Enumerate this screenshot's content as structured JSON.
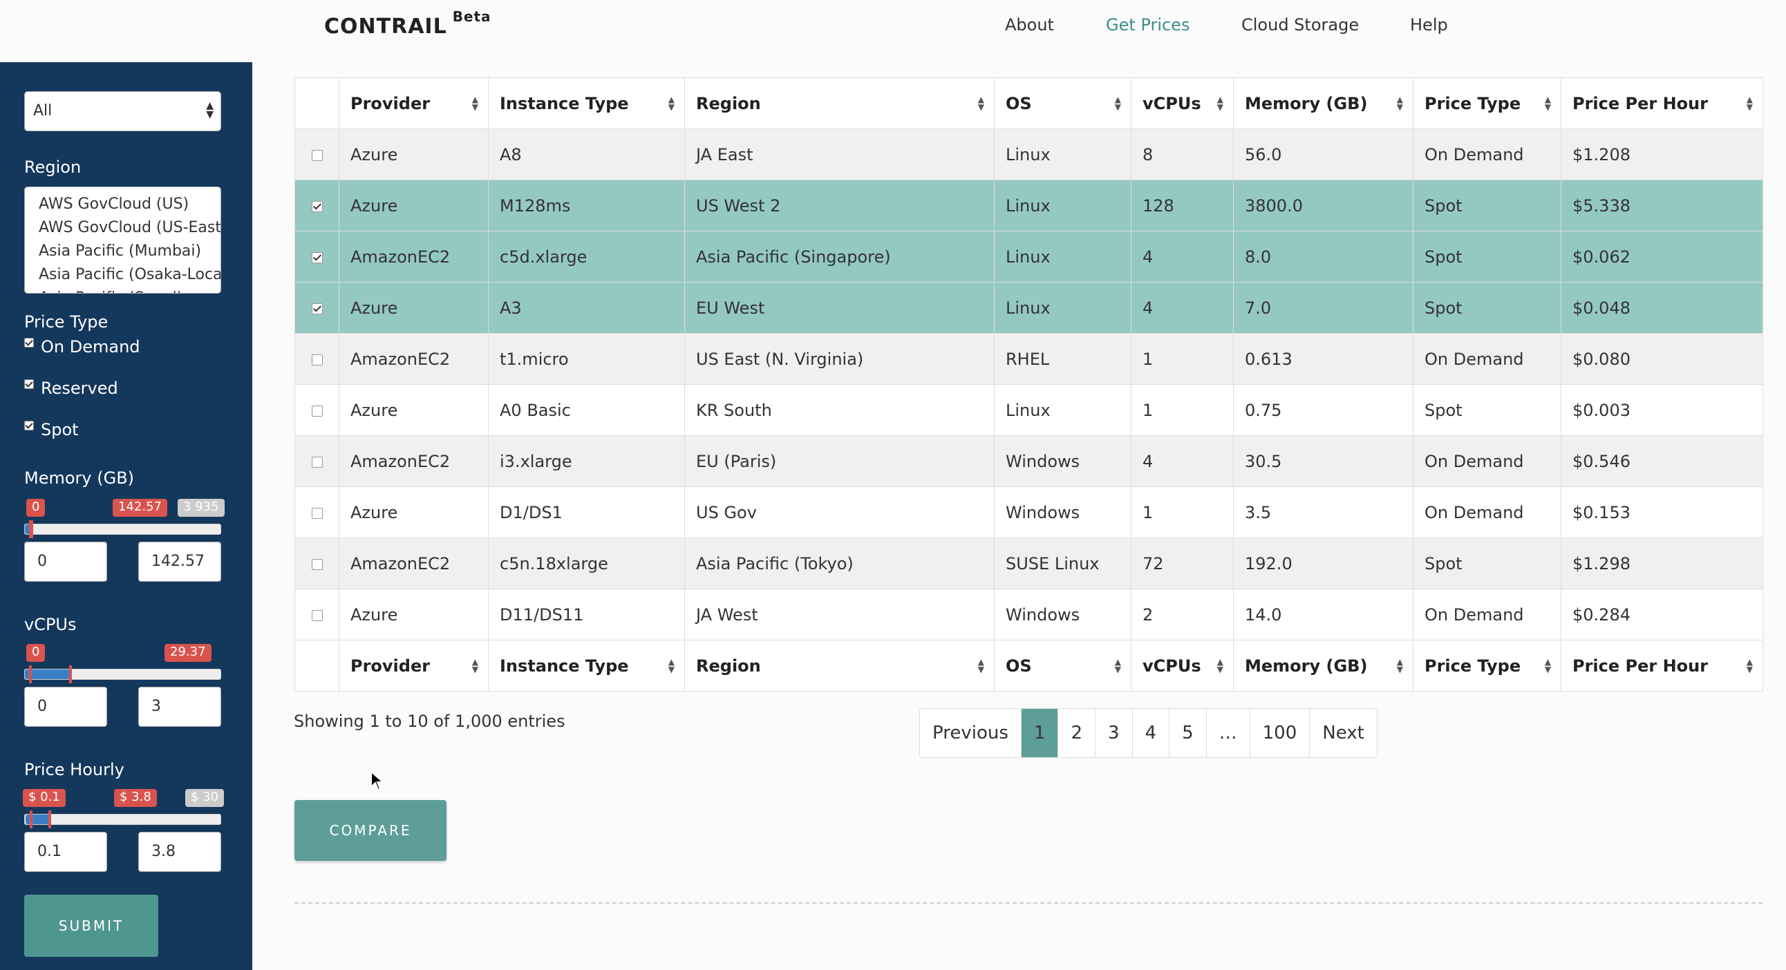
{
  "header": {
    "logo": "CONTRAIL",
    "logo_badge": "Beta",
    "nav": [
      "About",
      "Get Prices",
      "Cloud Storage",
      "Help"
    ]
  },
  "sidebar": {
    "provider_select": "All",
    "region_label": "Region",
    "regions": [
      "AWS GovCloud (US)",
      "AWS GovCloud (US-East)",
      "Asia Pacific (Mumbai)",
      "Asia Pacific (Osaka-Local)",
      "Asia Pacific (Seoul)"
    ],
    "price_type_label": "Price Type",
    "price_types": [
      {
        "label": "On Demand",
        "checked": true
      },
      {
        "label": "Reserved",
        "checked": true
      },
      {
        "label": "Spot",
        "checked": true
      }
    ],
    "memory": {
      "label": "Memory (GB)",
      "min_tag": "0",
      "cur_tag": "142.57",
      "max_tag": "3 935",
      "min": "0",
      "max": "142.57",
      "lo_frac": 0.0,
      "hi_frac": 0.036
    },
    "vcpus": {
      "label": "vCPUs",
      "min_tag": "0",
      "cur_tag": "29.37",
      "min": "0",
      "max": "3",
      "lo_frac": 0.0,
      "hi_frac": 0.23
    },
    "price_hourly": {
      "label": "Price Hourly",
      "min_tag": "$ 0.1",
      "cur_tag": "$ 3.8",
      "max_tag": "$ 30",
      "min": "0.1",
      "max": "3.8",
      "lo_frac": 0.003,
      "hi_frac": 0.127
    },
    "submit": "SUBMIT"
  },
  "table": {
    "columns": [
      "Provider",
      "Instance Type",
      "Region",
      "OS",
      "vCPUs",
      "Memory (GB)",
      "Price Type",
      "Price Per Hour"
    ],
    "rows": [
      {
        "checked": false,
        "cells": [
          "Azure",
          "A8",
          "JA East",
          "Linux",
          "8",
          "56.0",
          "On Demand",
          "$1.208"
        ]
      },
      {
        "checked": true,
        "cells": [
          "Azure",
          "M128ms",
          "US West 2",
          "Linux",
          "128",
          "3800.0",
          "Spot",
          "$5.338"
        ]
      },
      {
        "checked": true,
        "cells": [
          "AmazonEC2",
          "c5d.xlarge",
          "Asia Pacific (Singapore)",
          "Linux",
          "4",
          "8.0",
          "Spot",
          "$0.062"
        ]
      },
      {
        "checked": true,
        "cells": [
          "Azure",
          "A3",
          "EU West",
          "Linux",
          "4",
          "7.0",
          "Spot",
          "$0.048"
        ]
      },
      {
        "checked": false,
        "cells": [
          "AmazonEC2",
          "t1.micro",
          "US East (N. Virginia)",
          "RHEL",
          "1",
          "0.613",
          "On Demand",
          "$0.080"
        ]
      },
      {
        "checked": false,
        "cells": [
          "Azure",
          "A0 Basic",
          "KR South",
          "Linux",
          "1",
          "0.75",
          "Spot",
          "$0.003"
        ]
      },
      {
        "checked": false,
        "cells": [
          "AmazonEC2",
          "i3.xlarge",
          "EU (Paris)",
          "Windows",
          "4",
          "30.5",
          "On Demand",
          "$0.546"
        ]
      },
      {
        "checked": false,
        "cells": [
          "Azure",
          "D1/DS1",
          "US Gov",
          "Windows",
          "1",
          "3.5",
          "On Demand",
          "$0.153"
        ]
      },
      {
        "checked": false,
        "cells": [
          "AmazonEC2",
          "c5n.18xlarge",
          "Asia Pacific (Tokyo)",
          "SUSE Linux",
          "72",
          "192.0",
          "Spot",
          "$1.298"
        ]
      },
      {
        "checked": false,
        "cells": [
          "Azure",
          "D11/DS11",
          "JA West",
          "Windows",
          "2",
          "14.0",
          "On Demand",
          "$0.284"
        ]
      }
    ]
  },
  "info": "Showing 1 to 10 of 1,000 entries",
  "pagination": [
    "Previous",
    "1",
    "2",
    "3",
    "4",
    "5",
    "…",
    "100",
    "Next"
  ],
  "pagination_active": "1",
  "compare": "COMPARE"
}
